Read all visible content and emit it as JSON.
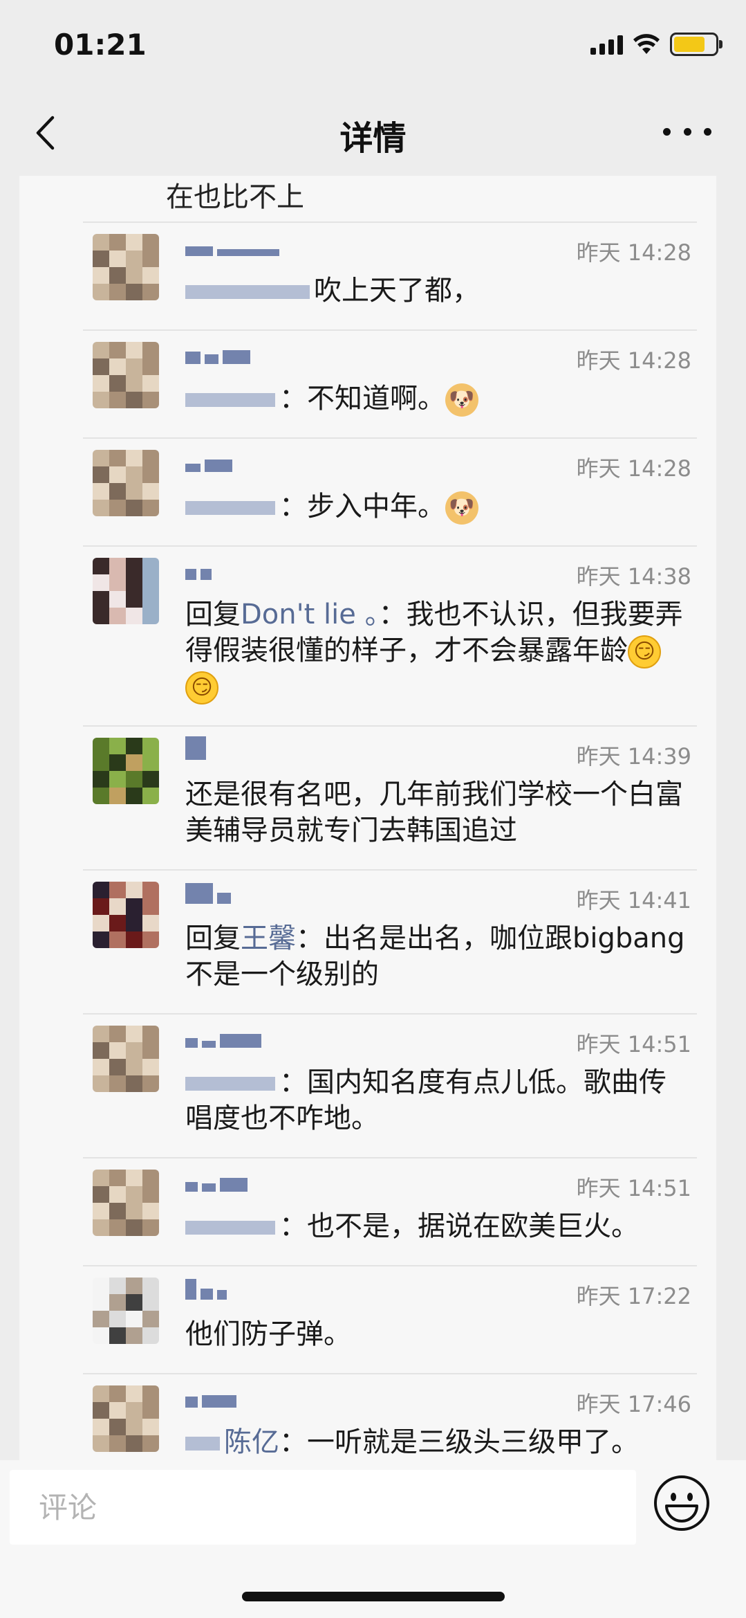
{
  "status_bar": {
    "time": "01:21"
  },
  "nav": {
    "title": "详情"
  },
  "top_fragment": "在也比不上",
  "comments": [
    {
      "time": "昨天 14:28",
      "prefix": "",
      "mention": "",
      "text": "吹上天了都，",
      "emoji": ""
    },
    {
      "time": "昨天 14:28",
      "prefix": "",
      "mention": "",
      "text": "：不知道啊。",
      "emoji": "dog"
    },
    {
      "time": "昨天 14:28",
      "prefix": "",
      "mention": "",
      "text": "：步入中年。",
      "emoji": "dog"
    },
    {
      "time": "昨天 14:38",
      "prefix": "回复",
      "mention": "Don't lie 。",
      "text": "：我也不认识，但我要弄得假装很懂的样子，才不会暴露年龄",
      "emoji": "smirk2"
    },
    {
      "time": "昨天 14:39",
      "prefix": "",
      "mention": "",
      "text": "还是很有名吧，几年前我们学校一个白富美辅导员就专门去韩国追过",
      "emoji": ""
    },
    {
      "time": "昨天 14:41",
      "prefix": "回复",
      "mention": "王馨",
      "text": "：出名是出名，咖位跟bigbang不是一个级别的",
      "emoji": ""
    },
    {
      "time": "昨天 14:51",
      "prefix": "",
      "mention": "",
      "text": "：国内知名度有点儿低。歌曲传唱度也不咋地。",
      "emoji": ""
    },
    {
      "time": "昨天 14:51",
      "prefix": "",
      "mention": "",
      "text": "：也不是，据说在欧美巨火。",
      "emoji": ""
    },
    {
      "time": "昨天 17:22",
      "prefix": "",
      "mention": "",
      "text": "他们防子弹。",
      "emoji": ""
    },
    {
      "time": "昨天 17:46",
      "prefix": "",
      "mention": "陈亿",
      "text": "：一听就是三级头三级甲了。",
      "emoji": ""
    }
  ],
  "input": {
    "placeholder": "评论"
  },
  "icons": {
    "back": "chevron-left-icon",
    "more": "more-dots-icon",
    "emoji": "smiley-face-icon",
    "battery_color": "#f4c400",
    "link_color": "#576b95"
  }
}
